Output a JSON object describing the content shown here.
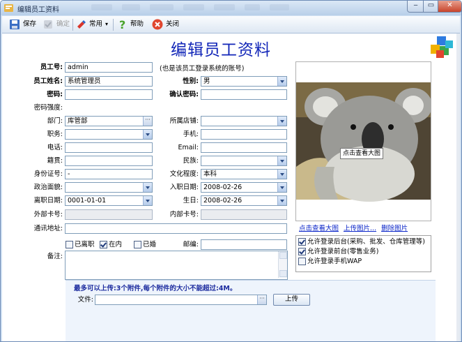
{
  "window": {
    "title": "编辑员工资料"
  },
  "toolbar": {
    "save": "保存",
    "confirm": "确定",
    "common": "常用",
    "help": "帮助",
    "close": "关闭"
  },
  "form": {
    "heading": "编辑员工资料",
    "employee_no": {
      "label": "员工号:",
      "value": "admin",
      "hint": "(也是该员工登录系统的账号)"
    },
    "employee_name": {
      "label": "员工姓名:",
      "value": "系统管理员"
    },
    "gender": {
      "label": "性别:",
      "value": "男"
    },
    "password": {
      "label": "密码:",
      "value": ""
    },
    "confirm_password": {
      "label": "确认密码:",
      "value": ""
    },
    "password_strength": {
      "label": "密码强度:"
    },
    "department": {
      "label": "部门:",
      "value": "库管部"
    },
    "store": {
      "label": "所属店铺:",
      "value": ""
    },
    "position": {
      "label": "职务:",
      "value": ""
    },
    "mobile": {
      "label": "手机:",
      "value": ""
    },
    "phone": {
      "label": "电话:",
      "value": ""
    },
    "email": {
      "label": "Email:",
      "value": ""
    },
    "native_place": {
      "label": "籍贯:",
      "value": ""
    },
    "ethnicity": {
      "label": "民族:",
      "value": ""
    },
    "id_number": {
      "label": "身份证号:",
      "value": "-"
    },
    "education": {
      "label": "文化程度:",
      "value": "本科"
    },
    "political_status": {
      "label": "政治面貌:",
      "value": ""
    },
    "hire_date": {
      "label": "入职日期:",
      "value": "2008-02-26"
    },
    "leave_date": {
      "label": "离职日期:",
      "value": "0001-01-01"
    },
    "birthday": {
      "label": "生日:",
      "value": "2008-02-26"
    },
    "external_card": {
      "label": "外部卡号:",
      "value": ""
    },
    "internal_card": {
      "label": "内部卡号:",
      "value": ""
    },
    "address": {
      "label": "通讯地址:",
      "value": ""
    },
    "status_checks": [
      {
        "label": "已离职",
        "checked": false
      },
      {
        "label": "在内",
        "checked": true
      },
      {
        "label": "已婚",
        "checked": false
      }
    ],
    "postcode": {
      "label": "邮编:",
      "value": ""
    },
    "remarks": {
      "label": "备注:",
      "value": ""
    }
  },
  "photo": {
    "tooltip": "点击查看大图"
  },
  "photo_links": {
    "view": "点击查看大图",
    "upload": "上传图片...",
    "delete": "删除图片"
  },
  "permissions": [
    {
      "label": "允许登录后台(采购、批发、仓库管理等)",
      "checked": true
    },
    {
      "label": "允许登录前台(零售业务)",
      "checked": true
    },
    {
      "label": "允许登录手机WAP",
      "checked": false
    }
  ],
  "attachments": {
    "note": "最多可以上传:3个附件,每个附件的大小不能超过:4M。",
    "file_label": "文件:",
    "file_value": "",
    "upload_button": "上传"
  },
  "colors": {
    "heading": "#1226b8",
    "link": "#0b26c9",
    "note": "#1d2c9f"
  }
}
